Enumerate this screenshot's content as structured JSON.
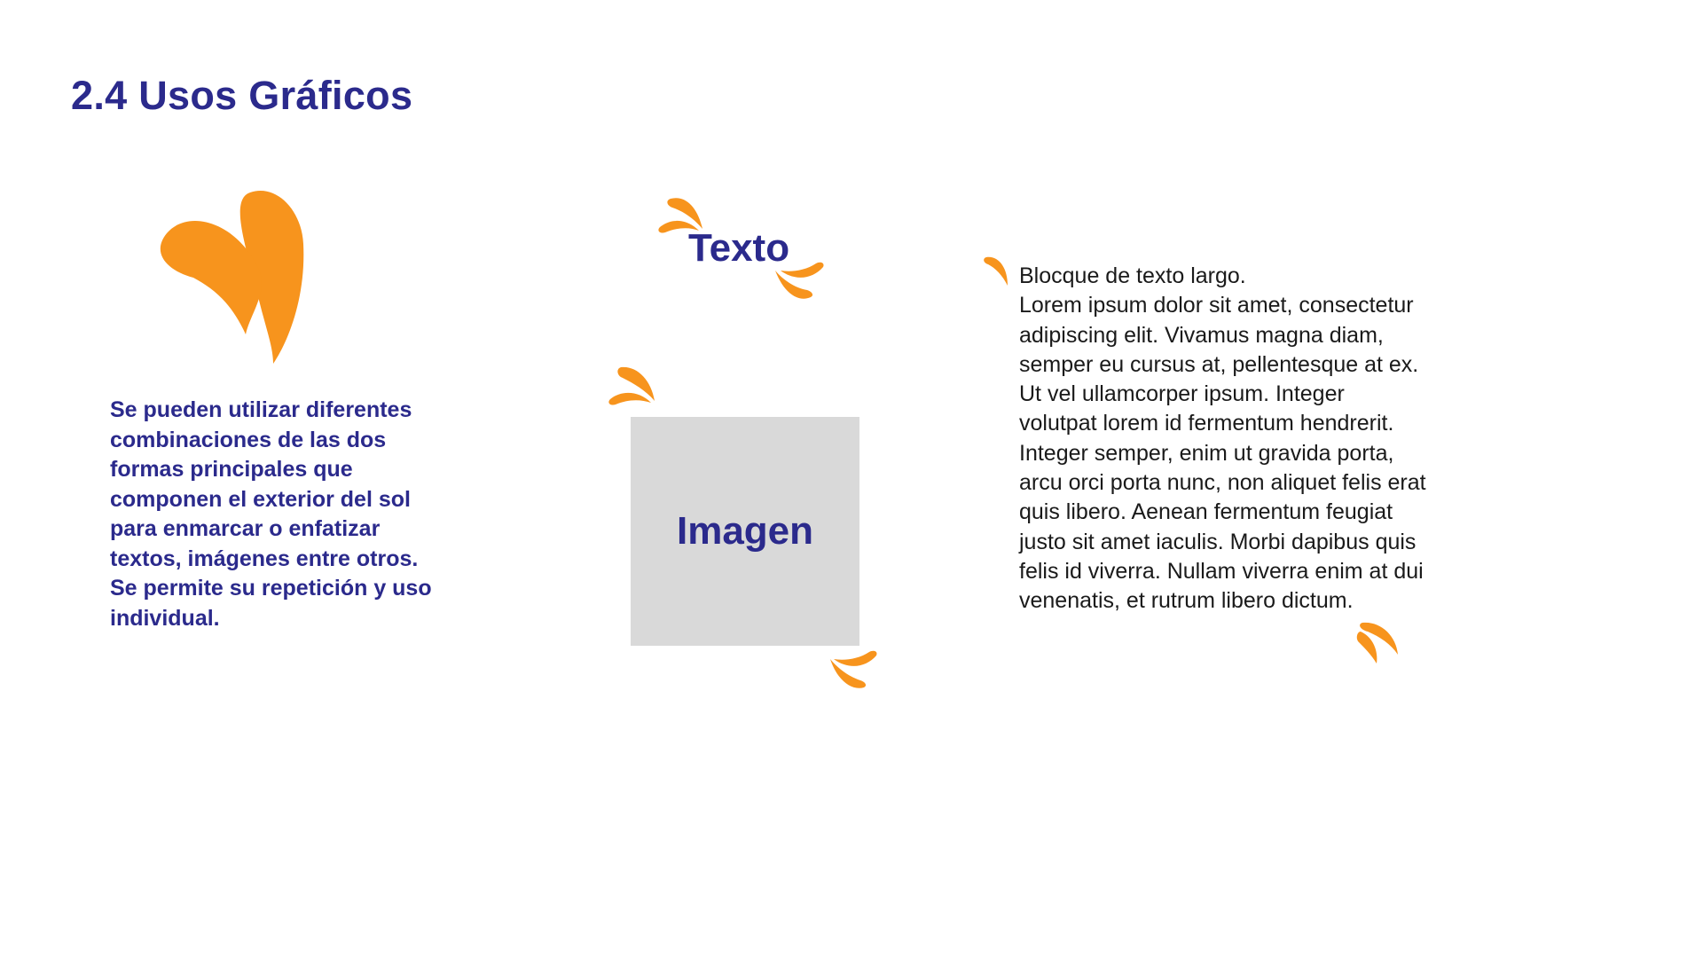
{
  "title": "2.4 Usos Gráficos",
  "description": "Se pueden utilizar diferentes combinaciones de las dos formas principales que componen el exterior del sol para enmarcar o enfatizar textos, imágenes entre otros. Se permite su repetición y uso individual.",
  "example_text_label": "Texto",
  "example_image_label": "Imagen",
  "long_text_block": {
    "heading": "Blocque de texto largo.",
    "body": "Lorem ipsum dolor sit amet, consectetur adipiscing elit. Vivamus magna diam, semper eu cursus at, pellentesque at ex. Ut vel ullamcorper ipsum. Integer volutpat lorem id fermentum hendrerit. Integer semper, enim ut gravida porta, arcu orci porta nunc, non aliquet felis erat quis libero. Aenean fermentum feugiat justo sit amet iaculis. Morbi dapibus quis felis id viverra. Nullam viverra enim at dui venenatis, et rutrum libero dictum."
  },
  "colors": {
    "brand_blue": "#2b2a8c",
    "brand_orange": "#f7941d",
    "placeholder_gray": "#d9d9d9"
  }
}
